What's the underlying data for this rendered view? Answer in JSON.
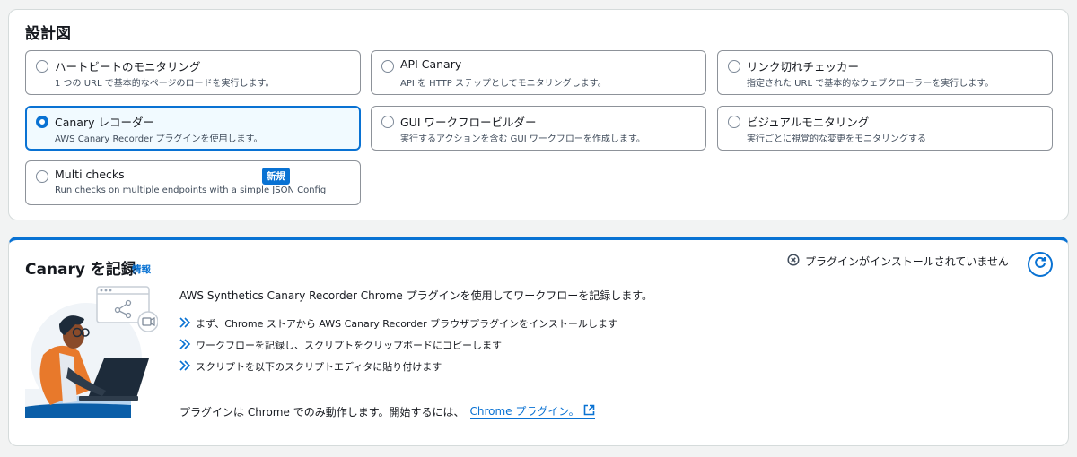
{
  "blueprints": {
    "title": "設計図",
    "options": [
      {
        "title": "ハートビートのモニタリング",
        "desc": "1 つの URL で基本的なページのロードを実行します。",
        "selected": false
      },
      {
        "title": "API Canary",
        "desc": "API を HTTP ステップとしてモニタリングします。",
        "selected": false
      },
      {
        "title": "リンク切れチェッカー",
        "desc": "指定された URL で基本的なウェブクローラーを実行します。",
        "selected": false
      },
      {
        "title": "Canary レコーダー",
        "desc": "AWS Canary Recorder プラグインを使用します。",
        "selected": true
      },
      {
        "title": "GUI ワークフロービルダー",
        "desc": "実行するアクションを含む GUI ワークフローを作成します。",
        "selected": false
      },
      {
        "title": "ビジュアルモニタリング",
        "desc": "実行ごとに視覚的な変更をモニタリングする",
        "selected": false
      },
      {
        "title": "Multi checks",
        "desc": "Run checks on multiple endpoints with a simple JSON Config",
        "selected": false,
        "badge": "新規"
      }
    ]
  },
  "recorder": {
    "title": "Canary を記録",
    "info_label": "情報",
    "status_text": "プラグインがインストールされていません",
    "description": "AWS Synthetics Canary Recorder Chrome プラグインを使用してワークフローを記録します。",
    "steps": [
      "まず、Chrome ストアから AWS Canary Recorder ブラウザプラグインをインストールします",
      "ワークフローを記録し、スクリプトをクリップボードにコピーします",
      "スクリプトを以下のスクリプトエディタに貼り付けます"
    ],
    "footer_text": "プラグインは Chrome でのみ動作します。開始するには、",
    "footer_link": "Chrome プラグイン。"
  },
  "colors": {
    "accent": "#0972d3",
    "border": "#d5dbdb",
    "text": "#16191f"
  }
}
